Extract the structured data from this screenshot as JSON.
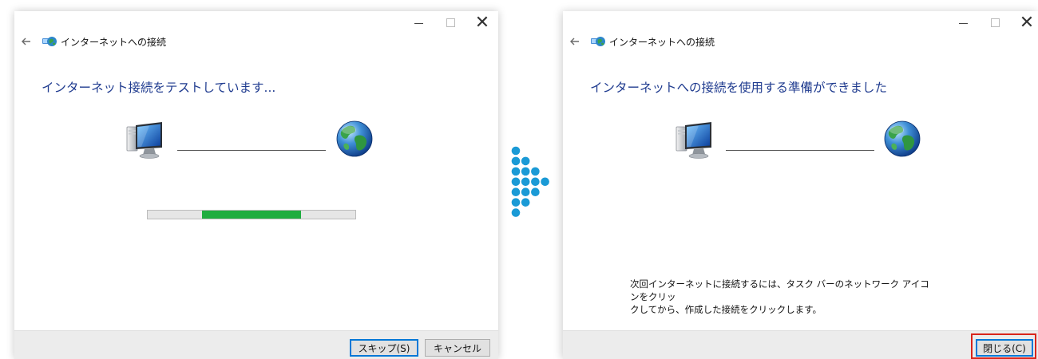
{
  "colors": {
    "heading": "#1f3b8f",
    "progress_fill": "#1fad3f",
    "arrow_dots": "#1a9ad6",
    "highlight": "#d9251b"
  },
  "left_window": {
    "title": "インターネットへの接続",
    "heading": "インターネット接続をテストしています...",
    "progress": 0.5,
    "buttons": {
      "skip": "スキップ(S)",
      "cancel": "キャンセル"
    }
  },
  "right_window": {
    "title": "インターネットへの接続",
    "heading": "インターネットへの接続を使用する準備ができました",
    "info_line1": "次回インターネットに接続するには、タスク バーのネットワーク アイコンをクリッ",
    "info_line2": "クしてから、作成した接続をクリックします。",
    "buttons": {
      "close": "閉じる(C)"
    }
  },
  "icons": {
    "back": "back-arrow-icon",
    "app": "network-connection-icon",
    "computer": "computer-icon",
    "globe": "globe-icon",
    "arrow": "dotted-right-arrow-icon"
  }
}
